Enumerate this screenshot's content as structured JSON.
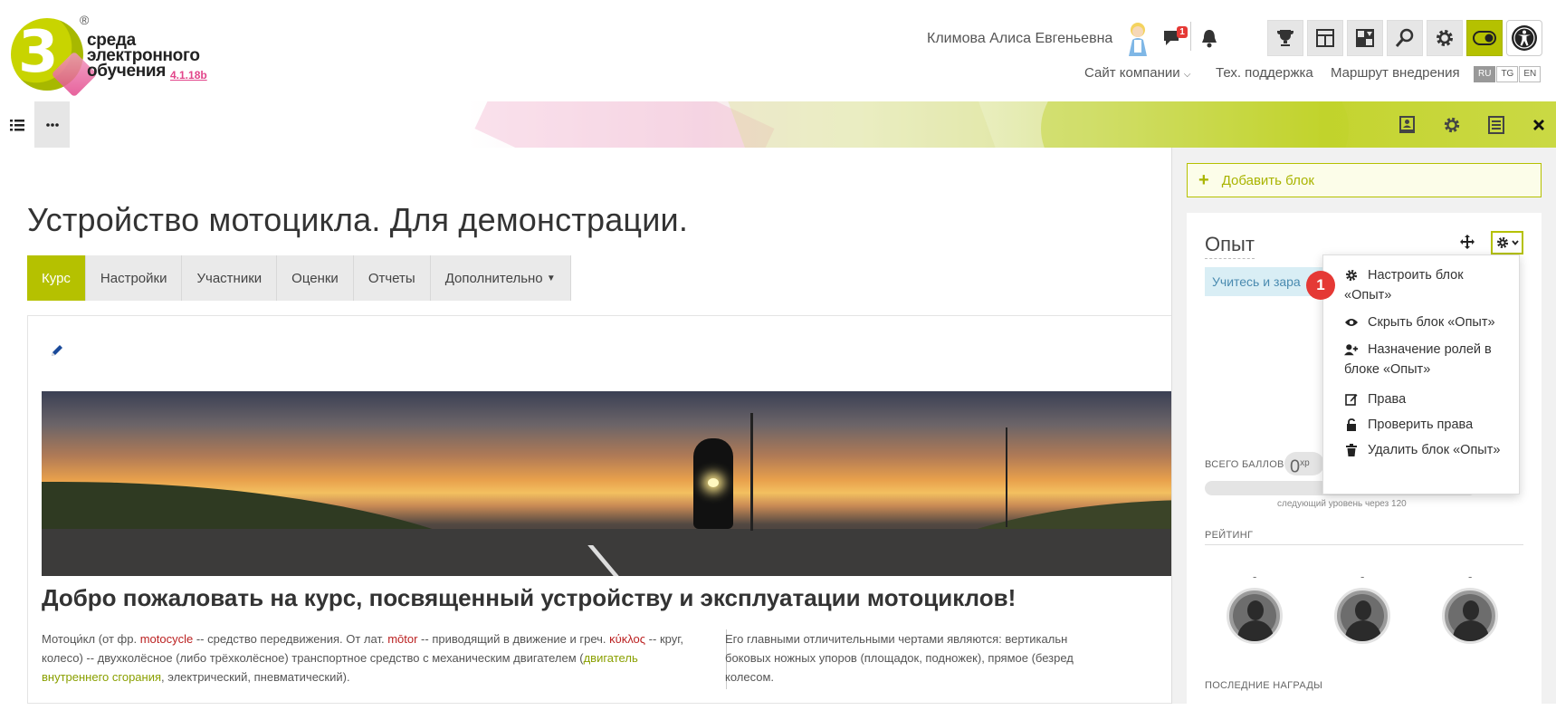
{
  "logo": {
    "line1": "среда",
    "line2": "электронного",
    "line3": "обучения",
    "version": "4.1.18b",
    "reg": "®"
  },
  "header": {
    "username": "Климова Алиса Евгеньевна",
    "messages_count": "1",
    "nav": {
      "company": "Сайт компании",
      "support": "Тех. поддержка",
      "route": "Маршрут внедрения"
    },
    "langs": [
      "RU",
      "TG",
      "EN"
    ]
  },
  "course": {
    "title": "Устройство мотоцикла. Для демонстрации.",
    "tabs": [
      "Курс",
      "Настройки",
      "Участники",
      "Оценки",
      "Отчеты",
      "Дополнительно"
    ],
    "welcome": "Добро пожаловать на курс, посвященный устройству и эксплуатации мотоциклов!",
    "col1": {
      "t1": "Мотоци́кл (от фр. ",
      "l1": "motocycle",
      "t2": " -- средство передвижения. От лат. ",
      "l2": "mōtor",
      "t3": " -- приводящий в движение и греч. ",
      "l3": "κύκλος",
      "t4": " -- круг, колесо) -- двухколёсное (либо трёхколёсное) транспортное средство с механическим двигателем (",
      "l4": "двигатель внутреннего сгорания",
      "t5": ", электрический, пневматический)."
    },
    "col2": {
      "line1": "Его главными отличительными чертами являются: вертикальн",
      "line2": "боковых ножных упоров (площадок, подножек), прямое (безред",
      "line3": "колесом."
    }
  },
  "sidebar": {
    "add_block": "Добавить блок",
    "block_title": "Опыт",
    "info_text": "Учитесь и зара",
    "total_label": "ВСЕГО БАЛЛОВ",
    "xp_value": "0",
    "xp_unit": "xp",
    "next_level_text": "следующий уровень через 120",
    "rating_label": "РЕЙТИНГ",
    "rating": [
      {
        "position": "-"
      },
      {
        "position": "-"
      },
      {
        "position": "-"
      }
    ],
    "awards_label": "ПОСЛЕДНИЕ НАГРАДЫ"
  },
  "menu": {
    "items": [
      {
        "icon": "cog-icon",
        "label": "Настроить блок «Опыт»"
      },
      {
        "icon": "eye-icon",
        "label": "Скрыть блок «Опыт»"
      },
      {
        "icon": "user-plus-icon",
        "label": "Назначение ролей в блоке «Опыт»"
      },
      {
        "icon": "edit-icon",
        "label": "Права"
      },
      {
        "icon": "unlock-icon",
        "label": "Проверить права"
      },
      {
        "icon": "trash-icon",
        "label": "Удалить блок «Опыт»"
      }
    ]
  },
  "annotation": {
    "step": "1"
  },
  "colors": {
    "accent": "#b5c100",
    "link_red": "#bb2222",
    "link_green": "#8aa000",
    "badge": "#e53935"
  }
}
